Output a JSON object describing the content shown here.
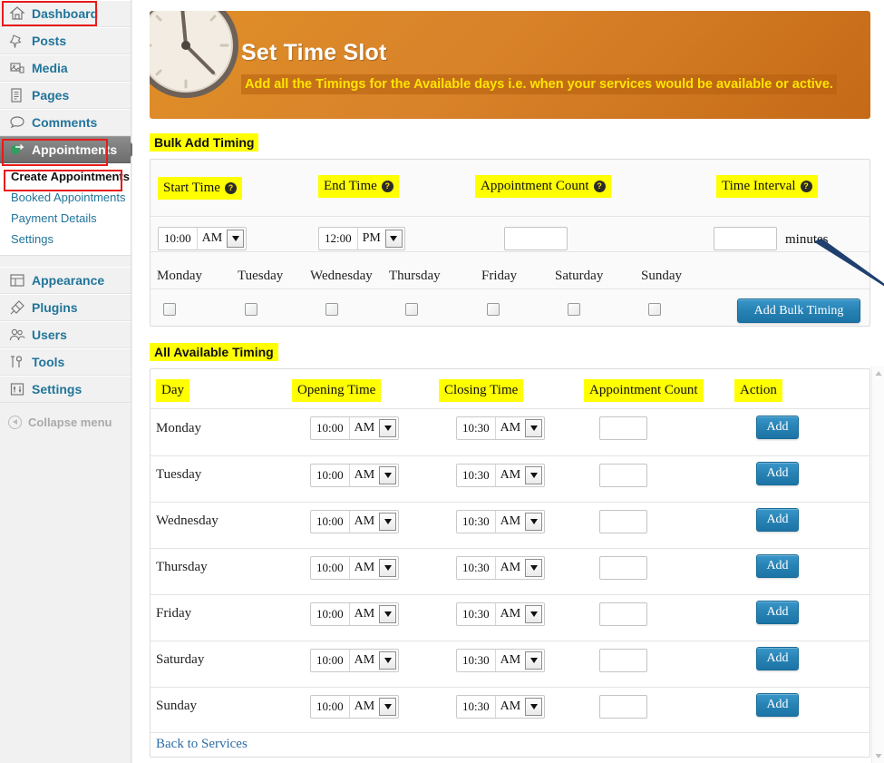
{
  "sidebar": {
    "items": [
      {
        "label": "Dashboard",
        "icon": "dashboard-icon",
        "current": false,
        "highlight": true
      },
      {
        "label": "Posts",
        "icon": "pin-icon",
        "current": false,
        "highlight": false
      },
      {
        "label": "Media",
        "icon": "media-icon",
        "current": false,
        "highlight": false
      },
      {
        "label": "Pages",
        "icon": "pages-icon",
        "current": false,
        "highlight": false
      },
      {
        "label": "Comments",
        "icon": "comment-icon",
        "current": false,
        "highlight": false
      },
      {
        "label": "Appointments",
        "icon": "appointments-icon",
        "current": true,
        "highlight": true
      }
    ],
    "submenu": [
      {
        "label": "Create Appointments",
        "current": true,
        "highlight": true
      },
      {
        "label": "Booked Appointments",
        "current": false,
        "highlight": false
      },
      {
        "label": "Payment Details",
        "current": false,
        "highlight": false
      },
      {
        "label": "Settings",
        "current": false,
        "highlight": false
      }
    ],
    "items_after": [
      {
        "label": "Appearance",
        "icon": "appearance-icon"
      },
      {
        "label": "Plugins",
        "icon": "plugin-icon"
      },
      {
        "label": "Users",
        "icon": "users-icon"
      },
      {
        "label": "Tools",
        "icon": "tools-icon"
      },
      {
        "label": "Settings",
        "icon": "settings-icon"
      }
    ],
    "collapse": {
      "label": "Collapse menu",
      "icon": "collapse-arrow-icon"
    }
  },
  "banner": {
    "title": "Set Time Slot",
    "subtitle": "Add all the Timings for the Available days i.e. when your services would be available or active.",
    "icon": "wall-clock-icon",
    "bg_color": "#d8822a",
    "title_color": "#ffffff",
    "subtitle_color": "#ffe400"
  },
  "bulk": {
    "section_label": "Bulk Add Timing",
    "headers": [
      {
        "label": "Start Time",
        "help": "?"
      },
      {
        "label": "End Time",
        "help": "?"
      },
      {
        "label": "Appointment Count",
        "help": "?"
      },
      {
        "label": "Time Interval",
        "help": "?"
      }
    ],
    "start_time": {
      "time": "10:00",
      "meridiem": "AM"
    },
    "end_time": {
      "time": "12:00",
      "meridiem": "PM"
    },
    "appointment_count": "",
    "time_interval": "",
    "minutes_label": "minutes",
    "days": [
      "Monday",
      "Tuesday",
      "Wednesday",
      "Thursday",
      "Friday",
      "Saturday",
      "Sunday"
    ],
    "day_checked": [
      false,
      false,
      false,
      false,
      false,
      false,
      false
    ],
    "add_button": "Add Bulk Timing"
  },
  "available": {
    "section_label": "All Available Timing",
    "headers": [
      "Day",
      "Opening Time",
      "Closing Time",
      "Appointment Count",
      "Action"
    ],
    "rows": [
      {
        "day": "Monday",
        "open_time": "10:00",
        "open_meridiem": "AM",
        "close_time": "10:30",
        "close_meridiem": "AM",
        "count": "",
        "action": "Add"
      },
      {
        "day": "Tuesday",
        "open_time": "10:00",
        "open_meridiem": "AM",
        "close_time": "10:30",
        "close_meridiem": "AM",
        "count": "",
        "action": "Add"
      },
      {
        "day": "Wednesday",
        "open_time": "10:00",
        "open_meridiem": "AM",
        "close_time": "10:30",
        "close_meridiem": "AM",
        "count": "",
        "action": "Add"
      },
      {
        "day": "Thursday",
        "open_time": "10:00",
        "open_meridiem": "AM",
        "close_time": "10:30",
        "close_meridiem": "AM",
        "count": "",
        "action": "Add"
      },
      {
        "day": "Friday",
        "open_time": "10:00",
        "open_meridiem": "AM",
        "close_time": "10:30",
        "close_meridiem": "AM",
        "count": "",
        "action": "Add"
      },
      {
        "day": "Saturday",
        "open_time": "10:00",
        "open_meridiem": "AM",
        "close_time": "10:30",
        "close_meridiem": "AM",
        "count": "",
        "action": "Add"
      },
      {
        "day": "Sunday",
        "open_time": "10:00",
        "open_meridiem": "AM",
        "close_time": "10:30",
        "close_meridiem": "AM",
        "count": "",
        "action": "Add"
      }
    ],
    "back_link": "Back to Services"
  },
  "annotations": {
    "arrow_color": "#1f3f6e",
    "highlight_color": "#ffff00",
    "box_color": "#e81b1b"
  }
}
